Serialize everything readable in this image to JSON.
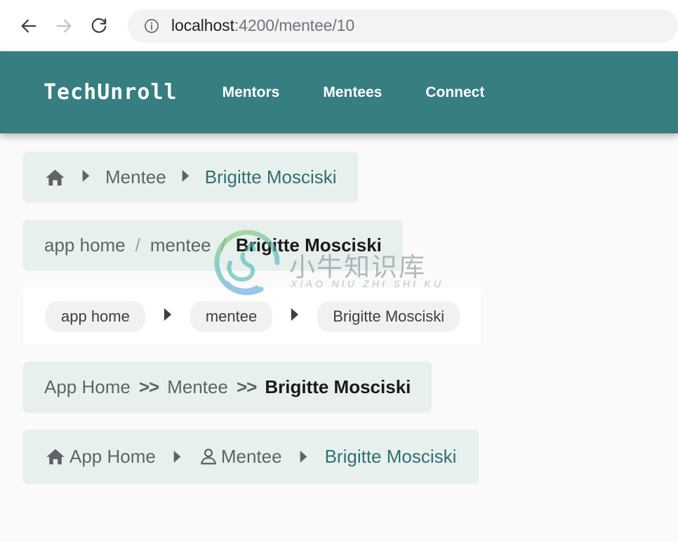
{
  "browser": {
    "back_label": "Back",
    "forward_label": "Forward",
    "reload_label": "Reload",
    "site_info_label": "View site information",
    "url_host": "localhost",
    "url_path": ":4200/mentee/10",
    "url_full": "localhost:4200/mentee/10"
  },
  "navbar": {
    "brand": "TechUnroll",
    "links": [
      {
        "label": "Mentors"
      },
      {
        "label": "Mentees"
      },
      {
        "label": "Connect"
      }
    ],
    "background_color": "#367e80"
  },
  "colors": {
    "accent_teal": "#367e80",
    "link_teal": "#2f7070",
    "tint_background": "#e8f0ee",
    "chip_background": "#f1f1f1",
    "muted_text": "#5f6368",
    "page_background": "#fafafa"
  },
  "breadcrumbs": [
    {
      "variant": "icon-home-arrow",
      "background": "tinted",
      "items": [
        {
          "label": "",
          "icon": "home-icon",
          "state": "link"
        },
        {
          "label": "Mentee",
          "state": "link"
        },
        {
          "label": "Brigitte Mosciski",
          "state": "current"
        }
      ],
      "separator": "triangle-right"
    },
    {
      "variant": "slash-lowercase",
      "background": "tinted",
      "items": [
        {
          "label": "app home",
          "state": "link"
        },
        {
          "label": "mentee",
          "state": "link"
        },
        {
          "label": "Brigitte Mosciski",
          "state": "current"
        }
      ],
      "separator": "/"
    },
    {
      "variant": "chips",
      "background": "plain",
      "items": [
        {
          "label": "app home",
          "state": "link"
        },
        {
          "label": "mentee",
          "state": "link"
        },
        {
          "label": "Brigitte Mosciski",
          "state": "current"
        }
      ],
      "separator": "triangle-right"
    },
    {
      "variant": "double-angle",
      "background": "tinted",
      "items": [
        {
          "label": "App Home",
          "state": "link"
        },
        {
          "label": "Mentee",
          "state": "link"
        },
        {
          "label": "Brigitte Mosciski",
          "state": "current"
        }
      ],
      "separator": ">>"
    },
    {
      "variant": "icons-with-labels",
      "background": "tinted",
      "items": [
        {
          "label": "App Home",
          "icon": "home-icon",
          "state": "link"
        },
        {
          "label": "Mentee",
          "icon": "person-icon",
          "state": "link"
        },
        {
          "label": "Brigitte Mosciski",
          "state": "current"
        }
      ],
      "separator": "triangle-right"
    }
  ],
  "watermark": {
    "chinese": "小牛知识库",
    "pinyin": "XIAO NIU ZHI SHI KU"
  }
}
